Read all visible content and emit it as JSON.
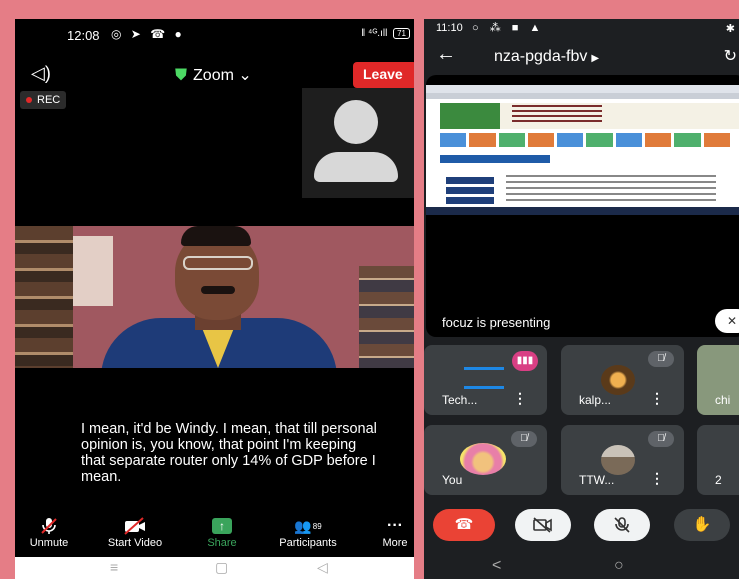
{
  "left_phone": {
    "status": {
      "time": "12:08",
      "icons": "Ⓢ ➤ ☎ ●",
      "signal": "≡ ᴴᵈ⁺ᴸᵀᴱ .ıll",
      "battery": "71"
    },
    "header": {
      "speaker_icon": "speaker-icon",
      "title": "Zoom",
      "leave_label": "Leave"
    },
    "rec_label": "REC",
    "caption": "I mean, it'd be Windy. I mean, that till personal opinion is, you know, that point I'm keeping that separate router only 14% of GDP before I mean.",
    "toolbar": {
      "unmute": "Unmute",
      "start_video": "Start Video",
      "share": "Share",
      "participants": "Participants",
      "participant_count": "89",
      "more": "More"
    },
    "colors": {
      "leave": "#e02828",
      "share": "#3aa45c",
      "shield": "#4cd964"
    }
  },
  "right_phone": {
    "status": {
      "time": "11:10"
    },
    "header": {
      "meeting_code": "nza-pgda-fbv"
    },
    "presenting_label": "focuz is presenting",
    "tiles": [
      {
        "name": "Tech...",
        "state": "speaking"
      },
      {
        "name": "kalp...",
        "state": "muted"
      },
      {
        "name": "chi",
        "state": "video"
      },
      {
        "name": "You",
        "state": "muted"
      },
      {
        "name": "TTW...",
        "state": "muted"
      },
      {
        "name": "2",
        "state": "muted"
      }
    ],
    "controls": [
      "end-call-icon",
      "camera-off-icon",
      "mic-off-icon",
      "raise-hand-icon"
    ],
    "colors": {
      "end_call": "#ea4335",
      "speaking_badge": "#d93f84"
    }
  }
}
